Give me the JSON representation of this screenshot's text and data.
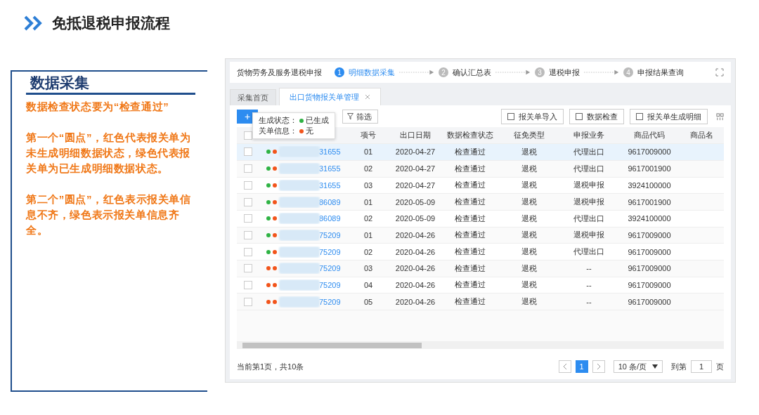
{
  "slide": {
    "title": "免抵退税申报流程"
  },
  "notes": {
    "heading": "数据采集",
    "paragraphs": [
      "数据检查状态要为“检查通过”",
      "第一个“圆点”，红色代表报关单为未生成明细数据状态，绿色代表报关单为已生成明细数据状态。",
      "第二个”圆点”，红色表示报关单信息不齐，绿色表示报关单信息齐全。"
    ]
  },
  "app": {
    "module": "货物劳务及服务退税申报",
    "steps": [
      {
        "number": "1",
        "label": "明细数据采集",
        "selected": true
      },
      {
        "number": "2",
        "label": "确认汇总表",
        "selected": false
      },
      {
        "number": "3",
        "label": "退税申报",
        "selected": false
      },
      {
        "number": "4",
        "label": "申报结果查询",
        "selected": false
      }
    ],
    "tabs": [
      {
        "label": "采集首页",
        "selected": false,
        "closable": false
      },
      {
        "label": "出口货物报关单管理",
        "selected": true,
        "closable": true
      }
    ],
    "toolbar": {
      "add": "+",
      "filter": "筛选",
      "buttons": [
        "报关单导入",
        "数据检查",
        "报关单生成明细"
      ]
    },
    "tooltip": {
      "lines": [
        {
          "label": "生成状态：",
          "generated": true,
          "value": "已生成"
        },
        {
          "label": "关单信息：",
          "generated": false,
          "value": "无"
        }
      ]
    },
    "table": {
      "columns": [
        "项号",
        "出口日期",
        "数据检查状态",
        "征免类型",
        "申报业务",
        "商品代码",
        "商品名"
      ],
      "header_checked": false,
      "rows": [
        {
          "generated": true,
          "info_complete": false,
          "number": "31655",
          "item": "01",
          "date": "2020-04-27",
          "check": "检查通过",
          "type": "退税",
          "business": "代理出口",
          "code": "9617009000",
          "selected": true
        },
        {
          "generated": true,
          "info_complete": false,
          "number": "31655",
          "item": "02",
          "date": "2020-04-27",
          "check": "检查通过",
          "type": "退税",
          "business": "代理出口",
          "code": "9617001900",
          "selected": false
        },
        {
          "generated": true,
          "info_complete": false,
          "number": "31655",
          "item": "03",
          "date": "2020-04-27",
          "check": "检查通过",
          "type": "退税",
          "business": "退税申报",
          "code": "3924100000",
          "selected": false
        },
        {
          "generated": true,
          "info_complete": false,
          "number": "86089",
          "item": "01",
          "date": "2020-05-09",
          "check": "检查通过",
          "type": "退税",
          "business": "退税申报",
          "code": "9617001900",
          "selected": false
        },
        {
          "generated": true,
          "info_complete": false,
          "number": "86089",
          "item": "02",
          "date": "2020-05-09",
          "check": "检查通过",
          "type": "退税",
          "business": "代理出口",
          "code": "3924100000",
          "selected": false
        },
        {
          "generated": true,
          "info_complete": false,
          "number": "75209",
          "item": "01",
          "date": "2020-04-26",
          "check": "检查通过",
          "type": "退税",
          "business": "退税申报",
          "code": "9617009000",
          "selected": false
        },
        {
          "generated": true,
          "info_complete": false,
          "number": "75209",
          "item": "02",
          "date": "2020-04-26",
          "check": "检查通过",
          "type": "退税",
          "business": "代理出口",
          "code": "9617009000",
          "selected": false
        },
        {
          "generated": false,
          "info_complete": false,
          "number": "75209",
          "item": "03",
          "date": "2020-04-26",
          "check": "检查通过",
          "type": "退税",
          "business": "--",
          "code": "9617009000",
          "selected": false
        },
        {
          "generated": false,
          "info_complete": false,
          "number": "75209",
          "item": "04",
          "date": "2020-04-26",
          "check": "检查通过",
          "type": "退税",
          "business": "--",
          "code": "9617009000",
          "selected": false
        },
        {
          "generated": false,
          "info_complete": false,
          "number": "75209",
          "item": "05",
          "date": "2020-04-26",
          "check": "检查通过",
          "type": "退税",
          "business": "--",
          "code": "9617009000",
          "selected": false
        }
      ]
    },
    "pagination": {
      "summary": "当前第1页，共10条",
      "pages": [
        {
          "label": "1",
          "selected": true
        }
      ],
      "page_size": "10 条/页",
      "goto_label": "到第",
      "goto_value": "1",
      "goto_suffix": "页"
    }
  }
}
